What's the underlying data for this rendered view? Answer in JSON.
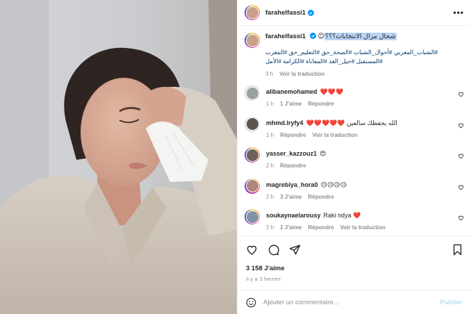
{
  "post": {
    "author": "farahelfassi1",
    "more_icon": "more-horizontal-icon",
    "caption": {
      "username": "farahelfassi1",
      "highlighted_text": "شحال مزال الانتخابات؟؟؟",
      "emoji": "😊",
      "hashtags": "#الشباب_المغربي #أحوال_الشباب #الصحة_حق #التعليم_حق #المغرب #المستقبل #جيل_الغد #المعاناة #الكرامة #الأمل",
      "time": "3 h",
      "translate": "Voir la traduction"
    },
    "comments": [
      {
        "username": "alibanemohamed",
        "text": "❤️❤️❤️",
        "time": "1 h",
        "likes": "1 J'aime",
        "reply": "Répondre",
        "translate": ""
      },
      {
        "username": "mhmd.lryfy4",
        "text": "الله يحفظك سالعين ❤️❤️❤️❤️❤️",
        "time": "1 h",
        "likes": "",
        "reply": "Répondre",
        "translate": "Voir la traduction"
      },
      {
        "username": "yasser_kazzouz1",
        "text": "😍",
        "time": "2 h",
        "likes": "",
        "reply": "Répondre",
        "translate": ""
      },
      {
        "username": "magrebiya_hora0",
        "text": "😥😥😥😥",
        "time": "2 h",
        "likes": "3 J'aime",
        "reply": "Répondre",
        "translate": ""
      },
      {
        "username": "soukaynaelarousy",
        "text": "Raki ndya ❤️",
        "time": "2 h",
        "likes": "1 J'aime",
        "reply": "Répondre",
        "translate": "Voir la traduction"
      }
    ],
    "like_count": "3 158 J'aime",
    "posted_ago": "Il y a 3 heures",
    "add_comment_placeholder": "Ajouter un commentaire...",
    "publish_label": "Publier",
    "icons": [
      "heart-icon",
      "comment-icon",
      "share-icon",
      "bookmark-icon",
      "emoji-icon",
      "verified-badge-icon"
    ],
    "colors": {
      "link": "#00376b",
      "muted": "#8e8e8e",
      "publish": "#b2dffc",
      "highlight": "#b9d3f5",
      "verified": "#0095f6"
    }
  }
}
